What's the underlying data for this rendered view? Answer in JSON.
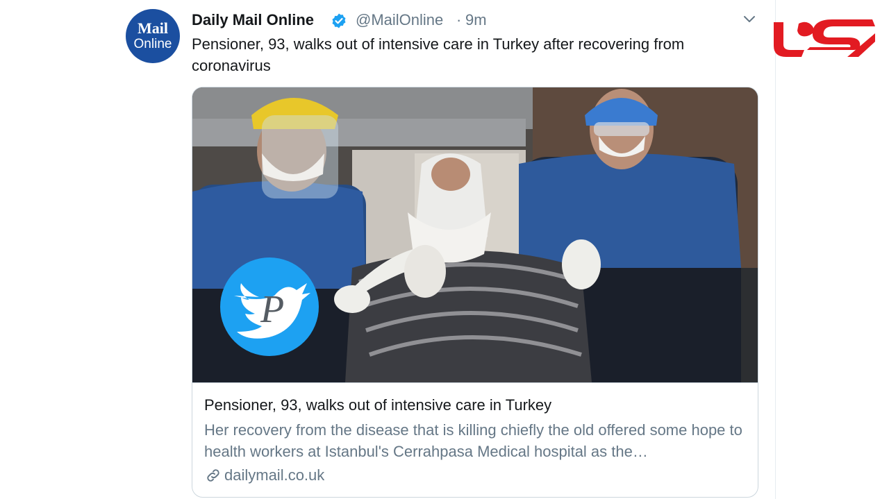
{
  "tweet": {
    "author_name": "Daily Mail Online",
    "handle": "@MailOnline",
    "separator": "·",
    "time": "9m",
    "text": "Pensioner, 93, walks out of intensive care in Turkey after recovering from coronavirus",
    "avatar": {
      "line1": "Mail",
      "line2": "Online"
    },
    "card": {
      "title": "Pensioner, 93, walks out of intensive care in Turkey",
      "description": "Her recovery from the disease that is killing chiefly the old offered some hope to health workers at Istanbul's Cerrahpasa Medical hospital as the…",
      "domain": "dailymail.co.uk",
      "image_icon": "twitter-bird-icon"
    }
  },
  "icons": {
    "verified": "verified-badge-icon",
    "caret": "chevron-down-icon",
    "link": "link-icon"
  },
  "colors": {
    "brand_blue": "#1da1f2",
    "mail_blue": "#1b4fa0",
    "text_primary": "#14171a",
    "text_secondary": "#657786",
    "logo_red": "#e21b22"
  }
}
